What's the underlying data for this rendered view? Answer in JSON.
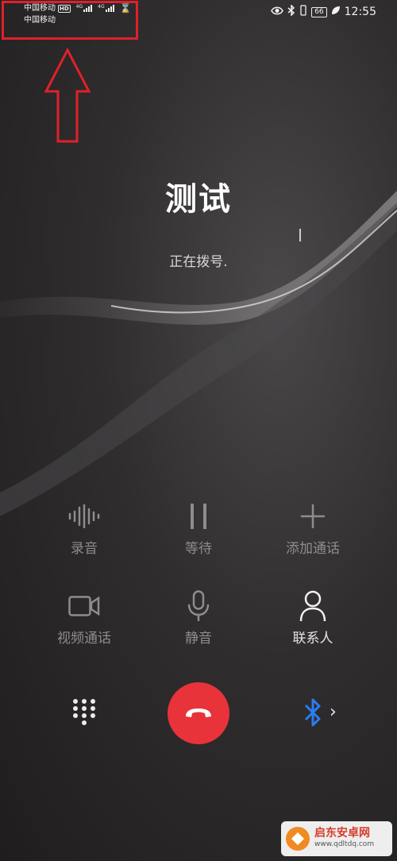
{
  "status_bar": {
    "carrier1": "中国移动",
    "carrier2": "中国移动",
    "hd_badge": "HD",
    "net1": "4G",
    "net2": "4G",
    "battery_level": "66",
    "time": "12:55"
  },
  "caller": {
    "name": "测试",
    "status": "正在拨号."
  },
  "controls": {
    "record": "录音",
    "hold": "等待",
    "add_call": "添加通话",
    "video_call": "视频通话",
    "mute": "静音",
    "contacts": "联系人"
  },
  "colors": {
    "end_call": "#e8333a",
    "bluetooth": "#2a7df0",
    "annotation": "#e0202a"
  },
  "watermark": {
    "title": "启东安卓网",
    "url": "www.qdltdq.com"
  }
}
